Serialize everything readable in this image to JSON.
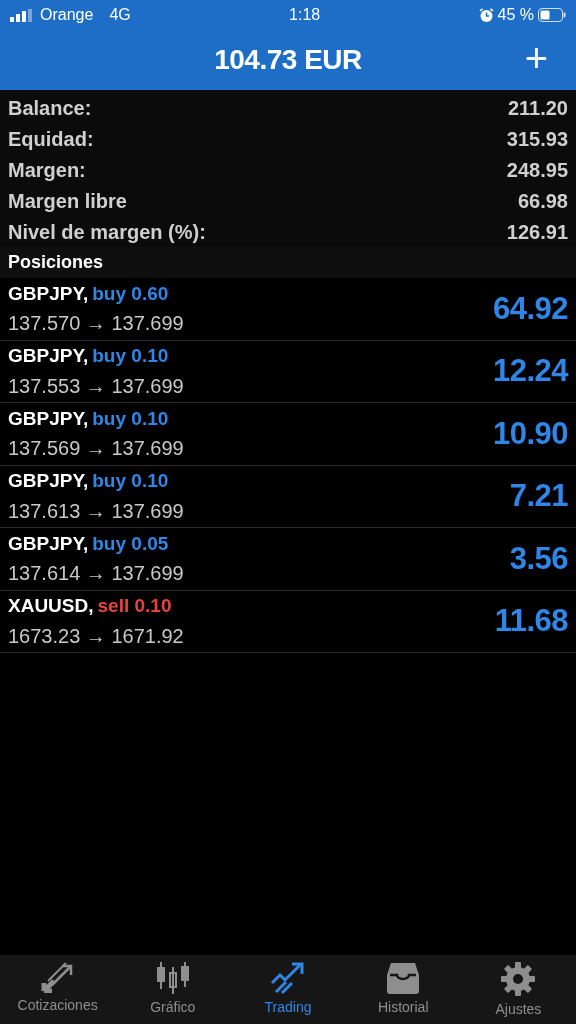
{
  "status_bar": {
    "carrier": "Orange",
    "network": "4G",
    "time": "1:18",
    "battery": "45 %"
  },
  "header": {
    "title": "104.73 EUR",
    "add": "+"
  },
  "summary": [
    {
      "label": "Balance:",
      "value": "211.20"
    },
    {
      "label": "Equidad:",
      "value": "315.93"
    },
    {
      "label": "Margen:",
      "value": "248.95"
    },
    {
      "label": "Margen libre",
      "value": "66.98"
    },
    {
      "label": "Nivel de margen (%):",
      "value": "126.91"
    }
  ],
  "positions_title": "Posiciones",
  "positions": [
    {
      "symbol": "GBPJPY,",
      "kind": "buy",
      "trade": "buy 0.60",
      "prices": "137.570 → 137.699",
      "profit": "64.92"
    },
    {
      "symbol": "GBPJPY,",
      "kind": "buy",
      "trade": "buy 0.10",
      "prices": "137.553 → 137.699",
      "profit": "12.24"
    },
    {
      "symbol": "GBPJPY,",
      "kind": "buy",
      "trade": "buy 0.10",
      "prices": "137.569 → 137.699",
      "profit": "10.90"
    },
    {
      "symbol": "GBPJPY,",
      "kind": "buy",
      "trade": "buy 0.10",
      "prices": "137.613 → 137.699",
      "profit": "7.21"
    },
    {
      "symbol": "GBPJPY,",
      "kind": "buy",
      "trade": "buy 0.05",
      "prices": "137.614 → 137.699",
      "profit": "3.56"
    },
    {
      "symbol": "XAUUSD,",
      "kind": "sell",
      "trade": "sell 0.10",
      "prices": "1673.23 → 1671.92",
      "profit": "11.68"
    }
  ],
  "tabs": [
    {
      "label": "Cotizaciones",
      "kind": "quotes",
      "selected": false
    },
    {
      "label": "Gráfico",
      "kind": "chart",
      "selected": false
    },
    {
      "label": "Trading",
      "kind": "trading",
      "selected": true
    },
    {
      "label": "Historial",
      "kind": "history",
      "selected": false
    },
    {
      "label": "Ajustes",
      "kind": "settings",
      "selected": false
    }
  ]
}
